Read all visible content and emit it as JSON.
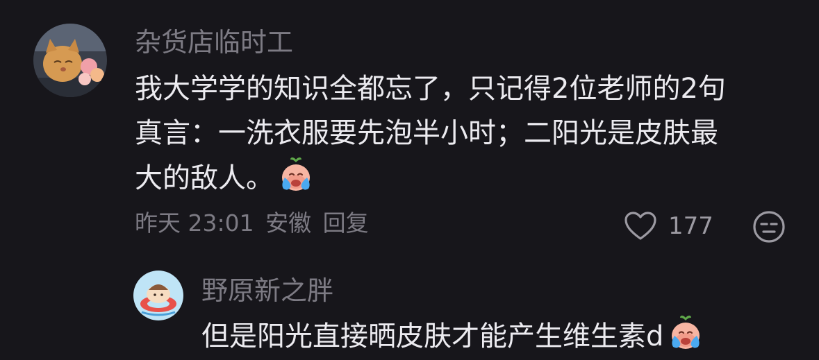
{
  "comment": {
    "username": "杂货店临时工",
    "lines": [
      "我大学学的知识全都忘了，只记得2位老师的2句",
      "真言：一洗衣服要先泡半小时；二阳光是皮肤最",
      "大的敌人。"
    ],
    "emoji": "crying-emoji",
    "meta": {
      "time": "昨天 23:01",
      "location": "安徽",
      "reply_label": "回复"
    },
    "like_count": "177"
  },
  "reply": {
    "username": "野原新之胖",
    "text": "但是阳光直接晒皮肤才能产生维生素d",
    "emoji": "crying-emoji"
  },
  "colors": {
    "background": "#17161b",
    "text_primary": "#ecebf0",
    "text_secondary": "#7d7b84",
    "icon": "#9c9aa2"
  }
}
